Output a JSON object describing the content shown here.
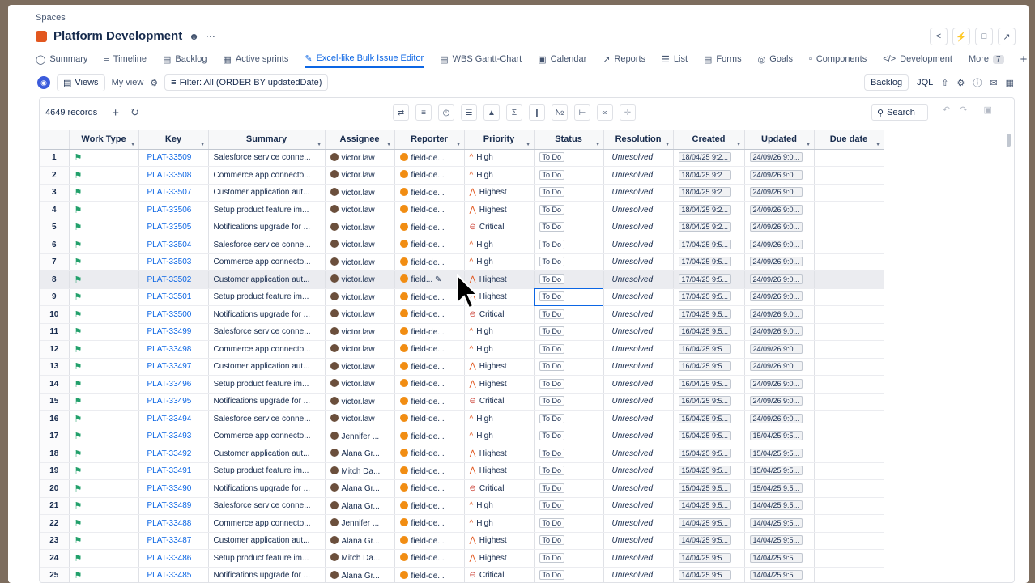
{
  "breadcrumb": "Spaces",
  "project": "Platform Development",
  "tabs": [
    {
      "label": "Summary",
      "icon": "globe-icon"
    },
    {
      "label": "Timeline",
      "icon": "timeline-icon"
    },
    {
      "label": "Backlog",
      "icon": "backlog-icon"
    },
    {
      "label": "Active sprints",
      "icon": "board-icon"
    },
    {
      "label": "Excel-like Bulk Issue Editor",
      "icon": "edit-icon",
      "active": true
    },
    {
      "label": "WBS Gantt-Chart",
      "icon": "gantt-icon"
    },
    {
      "label": "Calendar",
      "icon": "calendar-icon"
    },
    {
      "label": "Reports",
      "icon": "chart-icon"
    },
    {
      "label": "List",
      "icon": "list-icon"
    },
    {
      "label": "Forms",
      "icon": "forms-icon"
    },
    {
      "label": "Goals",
      "icon": "goal-icon"
    },
    {
      "label": "Components",
      "icon": "component-icon"
    },
    {
      "label": "Development",
      "icon": "code-icon"
    }
  ],
  "more_label": "More",
  "more_count": "7",
  "toolbar": {
    "views": "Views",
    "my_view": "My view",
    "filter": "Filter: All (ORDER BY updatedDate)",
    "backlog": "Backlog",
    "jql": "JQL"
  },
  "grid": {
    "records": "4649 records",
    "search": "Search"
  },
  "columns": [
    "",
    "Work Type",
    "Key",
    "Summary",
    "Assignee",
    "Reporter",
    "Priority",
    "Status",
    "Resolution",
    "Created",
    "Updated",
    "Due date"
  ],
  "rows": [
    {
      "n": "1",
      "key": "PLAT-33509",
      "summary": "Salesforce service conne...",
      "assignee": "victor.law",
      "reporter": "field-de...",
      "priority": "High",
      "status": "To Do",
      "res": "Unresolved",
      "created": "18/04/25 9:2...",
      "updated": "24/09/26 9:0..."
    },
    {
      "n": "2",
      "key": "PLAT-33508",
      "summary": "Commerce app connecto...",
      "assignee": "victor.law",
      "reporter": "field-de...",
      "priority": "High",
      "status": "To Do",
      "res": "Unresolved",
      "created": "18/04/25 9:2...",
      "updated": "24/09/26 9:0..."
    },
    {
      "n": "3",
      "key": "PLAT-33507",
      "summary": "Customer application aut...",
      "assignee": "victor.law",
      "reporter": "field-de...",
      "priority": "Highest",
      "status": "To Do",
      "res": "Unresolved",
      "created": "18/04/25 9:2...",
      "updated": "24/09/26 9:0..."
    },
    {
      "n": "4",
      "key": "PLAT-33506",
      "summary": "Setup product feature im...",
      "assignee": "victor.law",
      "reporter": "field-de...",
      "priority": "Highest",
      "status": "To Do",
      "res": "Unresolved",
      "created": "18/04/25 9:2...",
      "updated": "24/09/26 9:0..."
    },
    {
      "n": "5",
      "key": "PLAT-33505",
      "summary": "Notifications upgrade for ...",
      "assignee": "victor.law",
      "reporter": "field-de...",
      "priority": "Critical",
      "status": "To Do",
      "res": "Unresolved",
      "created": "18/04/25 9:2...",
      "updated": "24/09/26 9:0..."
    },
    {
      "n": "6",
      "key": "PLAT-33504",
      "summary": "Salesforce service conne...",
      "assignee": "victor.law",
      "reporter": "field-de...",
      "priority": "High",
      "status": "To Do",
      "res": "Unresolved",
      "created": "17/04/25 9:5...",
      "updated": "24/09/26 9:0..."
    },
    {
      "n": "7",
      "key": "PLAT-33503",
      "summary": "Commerce app connecto...",
      "assignee": "victor.law",
      "reporter": "field-de...",
      "priority": "High",
      "status": "To Do",
      "res": "Unresolved",
      "created": "17/04/25 9:5...",
      "updated": "24/09/26 9:0..."
    },
    {
      "n": "8",
      "key": "PLAT-33502",
      "summary": "Customer application aut...",
      "assignee": "victor.law",
      "reporter": "field...",
      "priority": "Highest",
      "status": "To Do",
      "res": "Unresolved",
      "created": "17/04/25 9:5...",
      "updated": "24/09/26 9:0..."
    },
    {
      "n": "9",
      "key": "PLAT-33501",
      "summary": "Setup product feature im...",
      "assignee": "victor.law",
      "reporter": "field-de...",
      "priority": "Highest",
      "status": "To Do",
      "res": "Unresolved",
      "created": "17/04/25 9:5...",
      "updated": "24/09/26 9:0..."
    },
    {
      "n": "10",
      "key": "PLAT-33500",
      "summary": "Notifications upgrade for ...",
      "assignee": "victor.law",
      "reporter": "field-de...",
      "priority": "Critical",
      "status": "To Do",
      "res": "Unresolved",
      "created": "17/04/25 9:5...",
      "updated": "24/09/26 9:0..."
    },
    {
      "n": "11",
      "key": "PLAT-33499",
      "summary": "Salesforce service conne...",
      "assignee": "victor.law",
      "reporter": "field-de...",
      "priority": "High",
      "status": "To Do",
      "res": "Unresolved",
      "created": "16/04/25 9:5...",
      "updated": "24/09/26 9:0..."
    },
    {
      "n": "12",
      "key": "PLAT-33498",
      "summary": "Commerce app connecto...",
      "assignee": "victor.law",
      "reporter": "field-de...",
      "priority": "High",
      "status": "To Do",
      "res": "Unresolved",
      "created": "16/04/25 9:5...",
      "updated": "24/09/26 9:0..."
    },
    {
      "n": "13",
      "key": "PLAT-33497",
      "summary": "Customer application aut...",
      "assignee": "victor.law",
      "reporter": "field-de...",
      "priority": "Highest",
      "status": "To Do",
      "res": "Unresolved",
      "created": "16/04/25 9:5...",
      "updated": "24/09/26 9:0..."
    },
    {
      "n": "14",
      "key": "PLAT-33496",
      "summary": "Setup product feature im...",
      "assignee": "victor.law",
      "reporter": "field-de...",
      "priority": "Highest",
      "status": "To Do",
      "res": "Unresolved",
      "created": "16/04/25 9:5...",
      "updated": "24/09/26 9:0..."
    },
    {
      "n": "15",
      "key": "PLAT-33495",
      "summary": "Notifications upgrade for ...",
      "assignee": "victor.law",
      "reporter": "field-de...",
      "priority": "Critical",
      "status": "To Do",
      "res": "Unresolved",
      "created": "16/04/25 9:5...",
      "updated": "24/09/26 9:0..."
    },
    {
      "n": "16",
      "key": "PLAT-33494",
      "summary": "Salesforce service conne...",
      "assignee": "victor.law",
      "reporter": "field-de...",
      "priority": "High",
      "status": "To Do",
      "res": "Unresolved",
      "created": "15/04/25 9:5...",
      "updated": "24/09/26 9:0..."
    },
    {
      "n": "17",
      "key": "PLAT-33493",
      "summary": "Commerce app connecto...",
      "assignee": "Jennifer ...",
      "reporter": "field-de...",
      "priority": "High",
      "status": "To Do",
      "res": "Unresolved",
      "created": "15/04/25 9:5...",
      "updated": "15/04/25 9:5..."
    },
    {
      "n": "18",
      "key": "PLAT-33492",
      "summary": "Customer application aut...",
      "assignee": "Alana Gr...",
      "reporter": "field-de...",
      "priority": "Highest",
      "status": "To Do",
      "res": "Unresolved",
      "created": "15/04/25 9:5...",
      "updated": "15/04/25 9:5..."
    },
    {
      "n": "19",
      "key": "PLAT-33491",
      "summary": "Setup product feature im...",
      "assignee": "Mitch Da...",
      "reporter": "field-de...",
      "priority": "Highest",
      "status": "To Do",
      "res": "Unresolved",
      "created": "15/04/25 9:5...",
      "updated": "15/04/25 9:5..."
    },
    {
      "n": "20",
      "key": "PLAT-33490",
      "summary": "Notifications upgrade for ...",
      "assignee": "Alana Gr...",
      "reporter": "field-de...",
      "priority": "Critical",
      "status": "To Do",
      "res": "Unresolved",
      "created": "15/04/25 9:5...",
      "updated": "15/04/25 9:5..."
    },
    {
      "n": "21",
      "key": "PLAT-33489",
      "summary": "Salesforce service conne...",
      "assignee": "Alana Gr...",
      "reporter": "field-de...",
      "priority": "High",
      "status": "To Do",
      "res": "Unresolved",
      "created": "14/04/25 9:5...",
      "updated": "14/04/25 9:5..."
    },
    {
      "n": "22",
      "key": "PLAT-33488",
      "summary": "Commerce app connecto...",
      "assignee": "Jennifer ...",
      "reporter": "field-de...",
      "priority": "High",
      "status": "To Do",
      "res": "Unresolved",
      "created": "14/04/25 9:5...",
      "updated": "14/04/25 9:5..."
    },
    {
      "n": "23",
      "key": "PLAT-33487",
      "summary": "Customer application aut...",
      "assignee": "Alana Gr...",
      "reporter": "field-de...",
      "priority": "Highest",
      "status": "To Do",
      "res": "Unresolved",
      "created": "14/04/25 9:5...",
      "updated": "14/04/25 9:5..."
    },
    {
      "n": "24",
      "key": "PLAT-33486",
      "summary": "Setup product feature im...",
      "assignee": "Mitch Da...",
      "reporter": "field-de...",
      "priority": "Highest",
      "status": "To Do",
      "res": "Unresolved",
      "created": "14/04/25 9:5...",
      "updated": "14/04/25 9:5..."
    },
    {
      "n": "25",
      "key": "PLAT-33485",
      "summary": "Notifications upgrade for ...",
      "assignee": "Alana Gr...",
      "reporter": "field-de...",
      "priority": "Critical",
      "status": "To Do",
      "res": "Unresolved",
      "created": "14/04/25 9:5...",
      "updated": "14/04/25 9:5..."
    }
  ],
  "colors": {
    "accent": "#0c66e4",
    "priority_high": "#e2571f",
    "priority_critical": "#c9372c",
    "worktype": "#22a06b"
  }
}
